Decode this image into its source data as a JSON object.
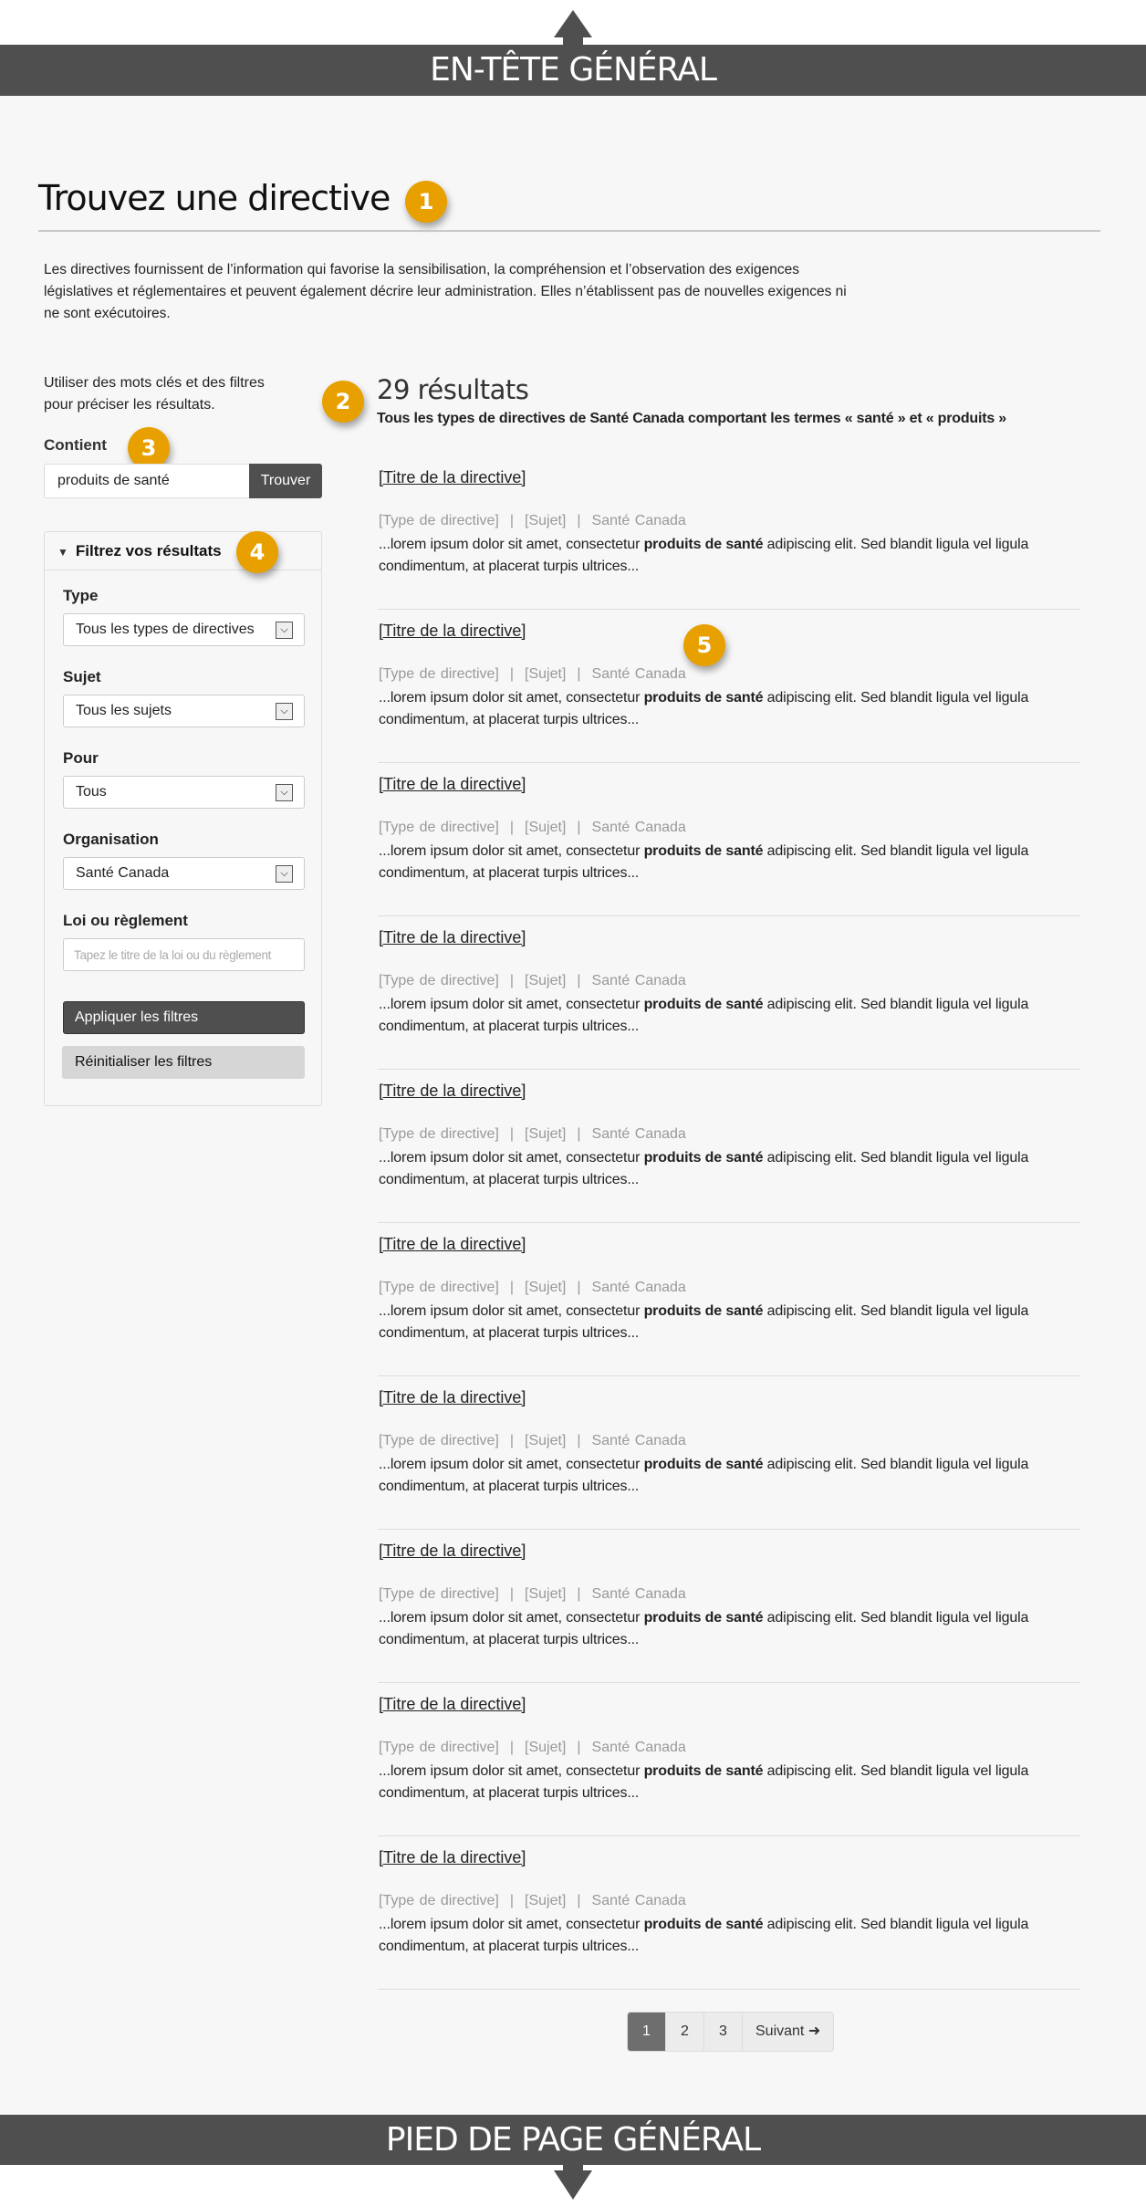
{
  "header": {
    "label": "EN-TÊTE GÉNÉRAL"
  },
  "footer": {
    "label": "PIED DE PAGE GÉNÉRAL"
  },
  "badges": [
    "1",
    "2",
    "3",
    "4",
    "5"
  ],
  "page": {
    "title": "Trouvez une directive",
    "intro": "Les directives fournissent de l’information qui favorise la sensibilisation, la compréhension et l’observation des exigences législatives et réglementaires et peuvent également décrire leur administration. Elles n’établissent pas de nouvelles exigences ni ne sont exécutoires."
  },
  "sidebar": {
    "hint": "Utiliser des mots clés et des filtres pour préciser les résultats.",
    "contient_label": "Contient",
    "search_value": "produits de santé",
    "search_button": "Trouver",
    "filters": {
      "heading": "Filtrez vos résultats",
      "type_label": "Type",
      "type_value": "Tous les types de directives",
      "sujet_label": "Sujet",
      "sujet_value": "Tous les sujets",
      "pour_label": "Pour",
      "pour_value": "Tous",
      "org_label": "Organisation",
      "org_value": "Santé Canada",
      "loi_label": "Loi ou règlement",
      "loi_placeholder": "Tapez le titre de la loi ou du règlement",
      "apply_button": "Appliquer les filtres",
      "reset_button": "Réinitialiser les filtres"
    }
  },
  "results": {
    "count": "29 résultats",
    "description": "Tous les types de directives de Santé Canada comportant les termes « santé » et « produits »",
    "items": [
      {
        "title": "[Titre de la directive]",
        "type": "[Type de directive]",
        "subject": "[Sujet]",
        "org": "Santé Canada",
        "snippet_pre": "...lorem ipsum dolor sit amet, consectetur ",
        "snippet_bold": "produits de santé",
        "snippet_post": " adipiscing elit. Sed blandit ligula vel ligula condimentum, at placerat turpis ultrices..."
      },
      {
        "title": "[Titre de la directive]",
        "type": "[Type de directive]",
        "subject": "[Sujet]",
        "org": "Santé Canada",
        "snippet_pre": "...lorem ipsum dolor sit amet, consectetur ",
        "snippet_bold": "produits de santé",
        "snippet_post": " adipiscing elit. Sed blandit ligula vel ligula condimentum, at placerat turpis ultrices..."
      },
      {
        "title": "[Titre de la directive]",
        "type": "[Type de directive]",
        "subject": "[Sujet]",
        "org": "Santé Canada",
        "snippet_pre": "...lorem ipsum dolor sit amet, consectetur ",
        "snippet_bold": "produits de santé",
        "snippet_post": " adipiscing elit. Sed blandit ligula vel ligula condimentum, at placerat turpis ultrices..."
      },
      {
        "title": "[Titre de la directive]",
        "type": "[Type de directive]",
        "subject": "[Sujet]",
        "org": "Santé Canada",
        "snippet_pre": "...lorem ipsum dolor sit amet, consectetur ",
        "snippet_bold": "produits de santé",
        "snippet_post": " adipiscing elit. Sed blandit ligula vel ligula condimentum, at placerat turpis ultrices..."
      },
      {
        "title": "[Titre de la directive]",
        "type": "[Type de directive]",
        "subject": "[Sujet]",
        "org": "Santé Canada",
        "snippet_pre": "...lorem ipsum dolor sit amet, consectetur ",
        "snippet_bold": "produits de santé",
        "snippet_post": " adipiscing elit. Sed blandit ligula vel ligula condimentum, at placerat turpis ultrices..."
      },
      {
        "title": "[Titre de la directive]",
        "type": "[Type de directive]",
        "subject": "[Sujet]",
        "org": "Santé Canada",
        "snippet_pre": "...lorem ipsum dolor sit amet, consectetur ",
        "snippet_bold": "produits de santé",
        "snippet_post": " adipiscing elit. Sed blandit ligula vel ligula condimentum, at placerat turpis ultrices..."
      },
      {
        "title": "[Titre de la directive]",
        "type": "[Type de directive]",
        "subject": "[Sujet]",
        "org": "Santé Canada",
        "snippet_pre": "...lorem ipsum dolor sit amet, consectetur ",
        "snippet_bold": "produits de santé",
        "snippet_post": " adipiscing elit. Sed blandit ligula vel ligula condimentum, at placerat turpis ultrices..."
      },
      {
        "title": "[Titre de la directive]",
        "type": "[Type de directive]",
        "subject": "[Sujet]",
        "org": "Santé Canada",
        "snippet_pre": "...lorem ipsum dolor sit amet, consectetur ",
        "snippet_bold": "produits de santé",
        "snippet_post": " adipiscing elit. Sed blandit ligula vel ligula condimentum, at placerat turpis ultrices..."
      },
      {
        "title": "[Titre de la directive]",
        "type": "[Type de directive]",
        "subject": "[Sujet]",
        "org": "Santé Canada",
        "snippet_pre": "...lorem ipsum dolor sit amet, consectetur ",
        "snippet_bold": "produits de santé",
        "snippet_post": " adipiscing elit. Sed blandit ligula vel ligula condimentum, at placerat turpis ultrices..."
      },
      {
        "title": "[Titre de la directive]",
        "type": "[Type de directive]",
        "subject": "[Sujet]",
        "org": "Santé Canada",
        "snippet_pre": "...lorem ipsum dolor sit amet, consectetur ",
        "snippet_bold": "produits de santé",
        "snippet_post": " adipiscing elit. Sed blandit ligula vel ligula condimentum, at placerat turpis ultrices..."
      }
    ],
    "meta_separator": "|"
  },
  "pagination": {
    "pages": [
      "1",
      "2",
      "3"
    ],
    "current": "1",
    "next_label": "Suivant",
    "next_icon": "➜"
  },
  "colors": {
    "band": "#4f4f4f",
    "badge": "#e8a000",
    "primary_button": "#4f4f4f",
    "secondary_button": "#d6d6d6",
    "active_page": "#6e6e6e"
  }
}
